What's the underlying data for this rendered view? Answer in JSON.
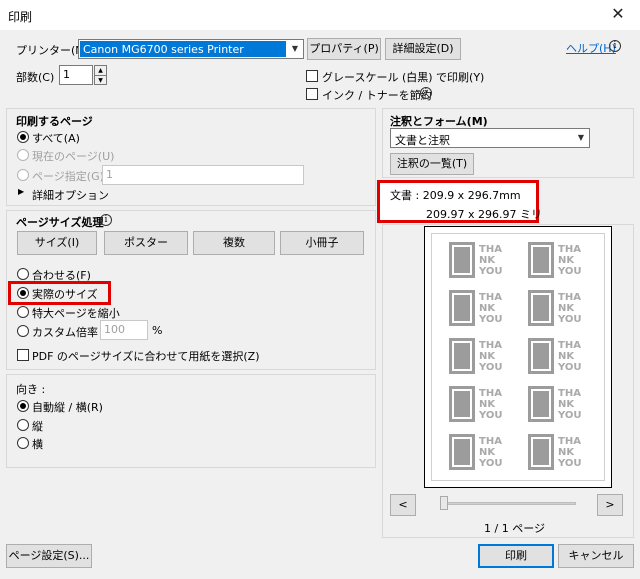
{
  "window": {
    "title": "印刷",
    "close_glyph": "✕"
  },
  "printer": {
    "label": "プリンター(N) :",
    "selected": "Canon MG6700 series Printer",
    "properties_label": "プロパティ(P)",
    "advanced_label": "詳細設定(D)",
    "help_label": "ヘルプ(H)"
  },
  "copies": {
    "label": "部数(C) :",
    "value": "1"
  },
  "options": {
    "grayscale_label": "グレースケール (白黒) で印刷(Y)",
    "save_ink_label": "インク / トナーを節約"
  },
  "pages_to_print": {
    "title": "印刷するページ",
    "all_label": "すべて(A)",
    "current_label": "現在のページ(U)",
    "range_label": "ページ指定(G)",
    "range_value": "1",
    "more_options_label": "詳細オプション"
  },
  "page_sizing": {
    "title": "ページサイズ処理",
    "tabs": [
      "サイズ(I)",
      "ポスター",
      "複数",
      "小冊子"
    ],
    "fit_label": "合わせる(F)",
    "actual_label": "実際のサイズ",
    "shrink_label": "特大ページを縮小",
    "custom_label": "カスタム倍率 :",
    "custom_value": "100",
    "custom_unit": "%",
    "pdf_paper_label": "PDF のページサイズに合わせて用紙を選択(Z)"
  },
  "orientation": {
    "title": "向き :",
    "auto_label": "自動縦 / 横(R)",
    "portrait_label": "縦",
    "landscape_label": "横"
  },
  "comments": {
    "title": "注釈とフォーム(M)",
    "selected": "文書と注釈",
    "summary_label": "注釈の一覧(T)"
  },
  "document_size": {
    "line1": "文書 : 209.9 x 296.7mm",
    "line2": "209.97 x 296.97 ミリ"
  },
  "preview": {
    "card_text": [
      "THA",
      "NK",
      "YOU"
    ],
    "prev_glyph": "<",
    "next_glyph": ">",
    "page_counter": "1 / 1 ページ"
  },
  "footer": {
    "page_setup_label": "ページ設定(S)...",
    "print_label": "印刷",
    "cancel_label": "キャンセル"
  },
  "colors": {
    "highlight": "#e00000",
    "selection": "#0078d7",
    "card_gray": "#9c9c9c"
  }
}
